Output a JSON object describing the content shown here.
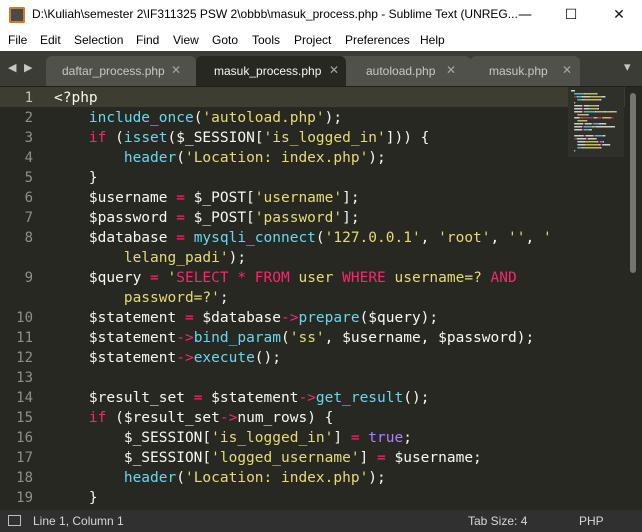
{
  "window": {
    "title": "D:\\Kuliah\\semester 2\\IF311325 PSW 2\\obbb\\masuk_process.php - Sublime Text (UNREG...",
    "minimize_glyph": "—",
    "maximize_glyph": "☐",
    "close_glyph": "✕"
  },
  "menu": [
    "File",
    "Edit",
    "Selection",
    "Find",
    "View",
    "Goto",
    "Tools",
    "Project",
    "Preferences",
    "Help"
  ],
  "tabs": [
    {
      "label": "daftar_process.php",
      "active": false
    },
    {
      "label": "masuk_process.php",
      "active": true
    },
    {
      "label": "autoload.php",
      "active": false
    },
    {
      "label": "masuk.php",
      "active": false
    }
  ],
  "tab_nav": {
    "left": "◀",
    "right": "▶",
    "close": "✕",
    "overflow": "▾"
  },
  "gutter": [
    "1",
    "2",
    "3",
    "4",
    "5",
    "6",
    "7",
    "8",
    "",
    "9",
    "",
    "10",
    "11",
    "12",
    "13",
    "14",
    "15",
    "16",
    "17",
    "18",
    "19"
  ],
  "code": [
    [
      [
        "p",
        "<?php"
      ]
    ],
    [
      [
        "p",
        "    "
      ],
      [
        "f",
        "include_once"
      ],
      [
        "p",
        "("
      ],
      [
        "s",
        "'autoload.php'"
      ],
      [
        "p",
        ");"
      ]
    ],
    [
      [
        "p",
        "    "
      ],
      [
        "k",
        "if"
      ],
      [
        "p",
        " ("
      ],
      [
        "f",
        "isset"
      ],
      [
        "p",
        "($_SESSION["
      ],
      [
        "s",
        "'is_logged_in'"
      ],
      [
        "p",
        "])) {"
      ]
    ],
    [
      [
        "p",
        "        "
      ],
      [
        "f",
        "header"
      ],
      [
        "p",
        "("
      ],
      [
        "s",
        "'Location: index.php'"
      ],
      [
        "p",
        ");"
      ]
    ],
    [
      [
        "p",
        "    }"
      ]
    ],
    [
      [
        "p",
        "    $username "
      ],
      [
        "k",
        "="
      ],
      [
        "p",
        " $_POST["
      ],
      [
        "s",
        "'username'"
      ],
      [
        "p",
        "];"
      ]
    ],
    [
      [
        "p",
        "    $password "
      ],
      [
        "k",
        "="
      ],
      [
        "p",
        " $_POST["
      ],
      [
        "s",
        "'password'"
      ],
      [
        "p",
        "];"
      ]
    ],
    [
      [
        "p",
        "    $database "
      ],
      [
        "k",
        "="
      ],
      [
        "p",
        " "
      ],
      [
        "f",
        "mysqli_connect"
      ],
      [
        "p",
        "("
      ],
      [
        "s",
        "'127.0.0.1'"
      ],
      [
        "p",
        ", "
      ],
      [
        "s",
        "'root'"
      ],
      [
        "p",
        ", "
      ],
      [
        "s",
        "''"
      ],
      [
        "p",
        ", "
      ],
      [
        "s",
        "'"
      ]
    ],
    [
      [
        "s",
        "        lelang_padi'"
      ],
      [
        "p",
        ");"
      ]
    ],
    [
      [
        "p",
        "    $query "
      ],
      [
        "k",
        "="
      ],
      [
        "p",
        " "
      ],
      [
        "s",
        "'"
      ],
      [
        "k",
        "SELECT * FROM"
      ],
      [
        "s",
        " user "
      ],
      [
        "k",
        "WHERE"
      ],
      [
        "s",
        " username=? "
      ],
      [
        "k",
        "AND"
      ]
    ],
    [
      [
        "s",
        "        password=?'"
      ],
      [
        "p",
        ";"
      ]
    ],
    [
      [
        "p",
        "    $statement "
      ],
      [
        "k",
        "="
      ],
      [
        "p",
        " $database"
      ],
      [
        "k",
        "->"
      ],
      [
        "f",
        "prepare"
      ],
      [
        "p",
        "($query);"
      ]
    ],
    [
      [
        "p",
        "    $statement"
      ],
      [
        "k",
        "->"
      ],
      [
        "f",
        "bind_param"
      ],
      [
        "p",
        "("
      ],
      [
        "s",
        "'ss'"
      ],
      [
        "p",
        ", $username, $password);"
      ]
    ],
    [
      [
        "p",
        "    $statement"
      ],
      [
        "k",
        "->"
      ],
      [
        "f",
        "execute"
      ],
      [
        "p",
        "();"
      ]
    ],
    [
      [
        "p",
        ""
      ]
    ],
    [
      [
        "p",
        "    $result_set "
      ],
      [
        "k",
        "="
      ],
      [
        "p",
        " $statement"
      ],
      [
        "k",
        "->"
      ],
      [
        "f",
        "get_result"
      ],
      [
        "p",
        "();"
      ]
    ],
    [
      [
        "p",
        "    "
      ],
      [
        "k",
        "if"
      ],
      [
        "p",
        " ($result_set"
      ],
      [
        "k",
        "->"
      ],
      [
        "p",
        "num_rows) {"
      ]
    ],
    [
      [
        "p",
        "        $_SESSION["
      ],
      [
        "s",
        "'is_logged_in'"
      ],
      [
        "p",
        "] "
      ],
      [
        "k",
        "="
      ],
      [
        "p",
        " "
      ],
      [
        "c",
        "true"
      ],
      [
        "p",
        ";"
      ]
    ],
    [
      [
        "p",
        "        $_SESSION["
      ],
      [
        "s",
        "'logged_username'"
      ],
      [
        "p",
        "] "
      ],
      [
        "k",
        "="
      ],
      [
        "p",
        " $username;"
      ]
    ],
    [
      [
        "p",
        "        "
      ],
      [
        "f",
        "header"
      ],
      [
        "p",
        "("
      ],
      [
        "s",
        "'Location: index.php'"
      ],
      [
        "p",
        ");"
      ]
    ],
    [
      [
        "p",
        "    }"
      ]
    ]
  ],
  "status": {
    "position": "Line 1, Column 1",
    "tab_size": "Tab Size: 4",
    "syntax": "PHP"
  },
  "colors": {
    "keyword": "#f92672",
    "function": "#66d9ef",
    "string": "#e6db74",
    "constant": "#ae81ff",
    "text": "#f8f8f2",
    "background": "#272822"
  }
}
